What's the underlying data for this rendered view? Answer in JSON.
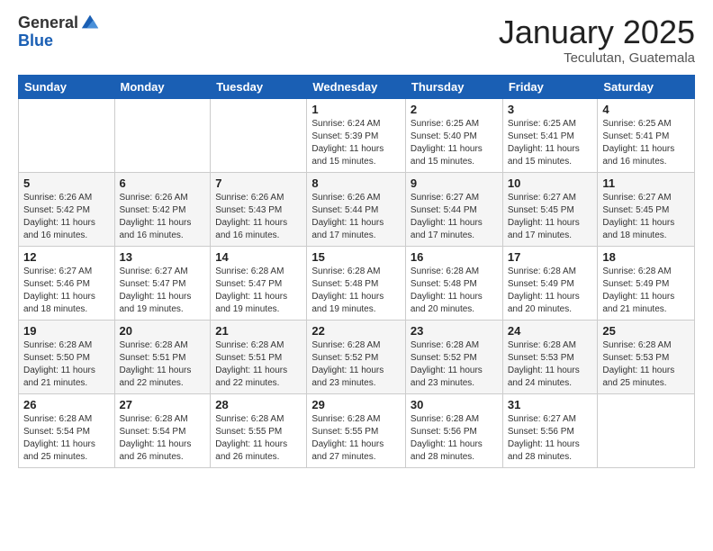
{
  "logo": {
    "general": "General",
    "blue": "Blue"
  },
  "header": {
    "month": "January 2025",
    "location": "Teculutan, Guatemala"
  },
  "weekdays": [
    "Sunday",
    "Monday",
    "Tuesday",
    "Wednesday",
    "Thursday",
    "Friday",
    "Saturday"
  ],
  "weeks": [
    [
      {
        "day": "",
        "info": ""
      },
      {
        "day": "",
        "info": ""
      },
      {
        "day": "",
        "info": ""
      },
      {
        "day": "1",
        "info": "Sunrise: 6:24 AM\nSunset: 5:39 PM\nDaylight: 11 hours and 15 minutes."
      },
      {
        "day": "2",
        "info": "Sunrise: 6:25 AM\nSunset: 5:40 PM\nDaylight: 11 hours and 15 minutes."
      },
      {
        "day": "3",
        "info": "Sunrise: 6:25 AM\nSunset: 5:41 PM\nDaylight: 11 hours and 15 minutes."
      },
      {
        "day": "4",
        "info": "Sunrise: 6:25 AM\nSunset: 5:41 PM\nDaylight: 11 hours and 16 minutes."
      }
    ],
    [
      {
        "day": "5",
        "info": "Sunrise: 6:26 AM\nSunset: 5:42 PM\nDaylight: 11 hours and 16 minutes."
      },
      {
        "day": "6",
        "info": "Sunrise: 6:26 AM\nSunset: 5:42 PM\nDaylight: 11 hours and 16 minutes."
      },
      {
        "day": "7",
        "info": "Sunrise: 6:26 AM\nSunset: 5:43 PM\nDaylight: 11 hours and 16 minutes."
      },
      {
        "day": "8",
        "info": "Sunrise: 6:26 AM\nSunset: 5:44 PM\nDaylight: 11 hours and 17 minutes."
      },
      {
        "day": "9",
        "info": "Sunrise: 6:27 AM\nSunset: 5:44 PM\nDaylight: 11 hours and 17 minutes."
      },
      {
        "day": "10",
        "info": "Sunrise: 6:27 AM\nSunset: 5:45 PM\nDaylight: 11 hours and 17 minutes."
      },
      {
        "day": "11",
        "info": "Sunrise: 6:27 AM\nSunset: 5:45 PM\nDaylight: 11 hours and 18 minutes."
      }
    ],
    [
      {
        "day": "12",
        "info": "Sunrise: 6:27 AM\nSunset: 5:46 PM\nDaylight: 11 hours and 18 minutes."
      },
      {
        "day": "13",
        "info": "Sunrise: 6:27 AM\nSunset: 5:47 PM\nDaylight: 11 hours and 19 minutes."
      },
      {
        "day": "14",
        "info": "Sunrise: 6:28 AM\nSunset: 5:47 PM\nDaylight: 11 hours and 19 minutes."
      },
      {
        "day": "15",
        "info": "Sunrise: 6:28 AM\nSunset: 5:48 PM\nDaylight: 11 hours and 19 minutes."
      },
      {
        "day": "16",
        "info": "Sunrise: 6:28 AM\nSunset: 5:48 PM\nDaylight: 11 hours and 20 minutes."
      },
      {
        "day": "17",
        "info": "Sunrise: 6:28 AM\nSunset: 5:49 PM\nDaylight: 11 hours and 20 minutes."
      },
      {
        "day": "18",
        "info": "Sunrise: 6:28 AM\nSunset: 5:49 PM\nDaylight: 11 hours and 21 minutes."
      }
    ],
    [
      {
        "day": "19",
        "info": "Sunrise: 6:28 AM\nSunset: 5:50 PM\nDaylight: 11 hours and 21 minutes."
      },
      {
        "day": "20",
        "info": "Sunrise: 6:28 AM\nSunset: 5:51 PM\nDaylight: 11 hours and 22 minutes."
      },
      {
        "day": "21",
        "info": "Sunrise: 6:28 AM\nSunset: 5:51 PM\nDaylight: 11 hours and 22 minutes."
      },
      {
        "day": "22",
        "info": "Sunrise: 6:28 AM\nSunset: 5:52 PM\nDaylight: 11 hours and 23 minutes."
      },
      {
        "day": "23",
        "info": "Sunrise: 6:28 AM\nSunset: 5:52 PM\nDaylight: 11 hours and 23 minutes."
      },
      {
        "day": "24",
        "info": "Sunrise: 6:28 AM\nSunset: 5:53 PM\nDaylight: 11 hours and 24 minutes."
      },
      {
        "day": "25",
        "info": "Sunrise: 6:28 AM\nSunset: 5:53 PM\nDaylight: 11 hours and 25 minutes."
      }
    ],
    [
      {
        "day": "26",
        "info": "Sunrise: 6:28 AM\nSunset: 5:54 PM\nDaylight: 11 hours and 25 minutes."
      },
      {
        "day": "27",
        "info": "Sunrise: 6:28 AM\nSunset: 5:54 PM\nDaylight: 11 hours and 26 minutes."
      },
      {
        "day": "28",
        "info": "Sunrise: 6:28 AM\nSunset: 5:55 PM\nDaylight: 11 hours and 26 minutes."
      },
      {
        "day": "29",
        "info": "Sunrise: 6:28 AM\nSunset: 5:55 PM\nDaylight: 11 hours and 27 minutes."
      },
      {
        "day": "30",
        "info": "Sunrise: 6:28 AM\nSunset: 5:56 PM\nDaylight: 11 hours and 28 minutes."
      },
      {
        "day": "31",
        "info": "Sunrise: 6:27 AM\nSunset: 5:56 PM\nDaylight: 11 hours and 28 minutes."
      },
      {
        "day": "",
        "info": ""
      }
    ]
  ]
}
